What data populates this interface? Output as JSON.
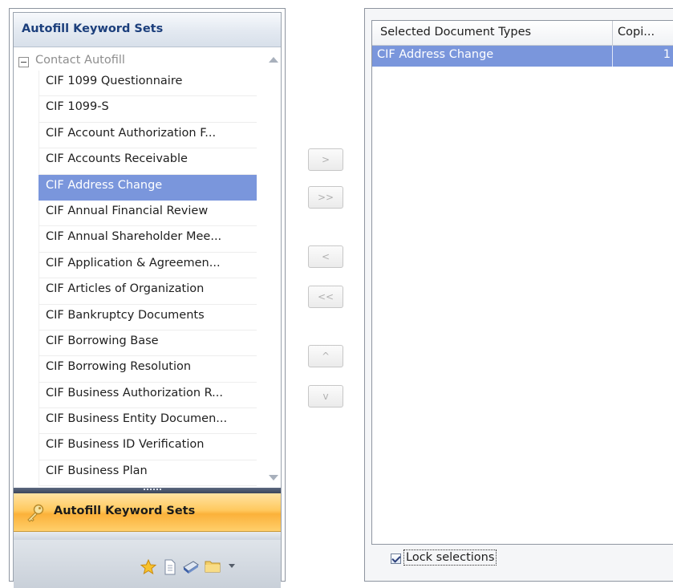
{
  "left_panel": {
    "header": "Autofill Keyword Sets",
    "group": {
      "label": "Contact Autofill",
      "expanded": true
    },
    "items": [
      {
        "label": "CIF 1099 Questionnaire",
        "selected": false
      },
      {
        "label": "CIF 1099-S",
        "selected": false
      },
      {
        "label": "CIF Account Authorization F...",
        "selected": false
      },
      {
        "label": "CIF Accounts Receivable",
        "selected": false
      },
      {
        "label": "CIF Address Change",
        "selected": true
      },
      {
        "label": "CIF Annual Financial Review",
        "selected": false
      },
      {
        "label": "CIF Annual Shareholder Mee...",
        "selected": false
      },
      {
        "label": "CIF Application & Agreemen...",
        "selected": false
      },
      {
        "label": "CIF Articles of Organization",
        "selected": false
      },
      {
        "label": "CIF Bankruptcy Documents",
        "selected": false
      },
      {
        "label": "CIF Borrowing Base",
        "selected": false
      },
      {
        "label": "CIF Borrowing Resolution",
        "selected": false
      },
      {
        "label": "CIF Business Authorization R...",
        "selected": false
      },
      {
        "label": "CIF Business Entity Documen...",
        "selected": false
      },
      {
        "label": "CIF Business ID Verification",
        "selected": false
      },
      {
        "label": "CIF Business Plan",
        "selected": false
      }
    ],
    "nav_button": {
      "label": "Autofill Keyword Sets",
      "icon": "key-icon"
    },
    "toolbar_icons": [
      "star-icon",
      "document-icon",
      "scanner-icon",
      "folder-icon",
      "dropdown-arrow-icon"
    ]
  },
  "move_buttons": {
    "add": ">",
    "add_all": ">>",
    "remove": "<",
    "remove_all": "<<",
    "move_up": "^",
    "move_down": "v"
  },
  "right_panel": {
    "columns": [
      "Selected Document Types",
      "Copi..."
    ],
    "rows": [
      {
        "type": "CIF Address Change",
        "copies": "1",
        "selected": true
      }
    ],
    "lock_selections": {
      "label": "Lock selections",
      "checked": true
    }
  },
  "colors": {
    "selection": "#7a96dc",
    "header_text": "#1c3f7c",
    "nav_orange": "#fbb13a"
  }
}
